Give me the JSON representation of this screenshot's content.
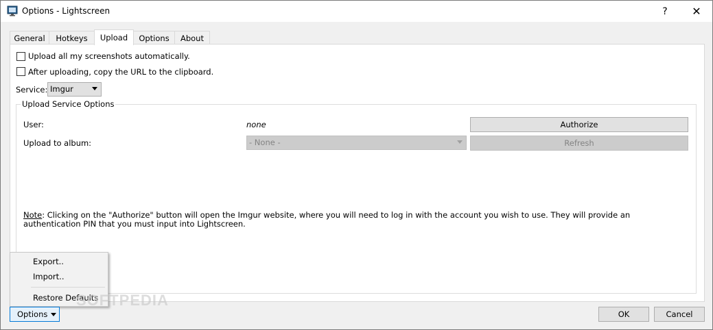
{
  "window": {
    "title": "Options - Lightscreen",
    "help": "?",
    "close": "✕"
  },
  "tabs": [
    {
      "label": "General"
    },
    {
      "label": "Hotkeys"
    },
    {
      "label": "Upload"
    },
    {
      "label": "Options"
    },
    {
      "label": "About"
    }
  ],
  "upload": {
    "auto_upload_label": "Upload all my screenshots automatically.",
    "copy_url_label": "After uploading, copy the URL to the clipboard.",
    "service_label": "Service:",
    "service_value": "Imgur",
    "group_title": "Upload Service Options",
    "user_label": "User:",
    "user_value": "none",
    "album_label": "Upload to album:",
    "album_value": "- None -",
    "authorize_label": "Authorize",
    "refresh_label": "Refresh",
    "note_prefix": "Note",
    "note_text": ": Clicking on the \"Authorize\" button will open the Imgur website, where you will need to log in with the account you wish to use. They will provide an authentication PIN that you must input into Lightscreen."
  },
  "options_menu": {
    "items": [
      {
        "label": "Export.."
      },
      {
        "label": "Import.."
      },
      {
        "label": "Restore Defaults"
      }
    ]
  },
  "footer": {
    "options_label": "Options",
    "ok_label": "OK",
    "cancel_label": "Cancel"
  },
  "watermark": "SOFTPEDIA"
}
